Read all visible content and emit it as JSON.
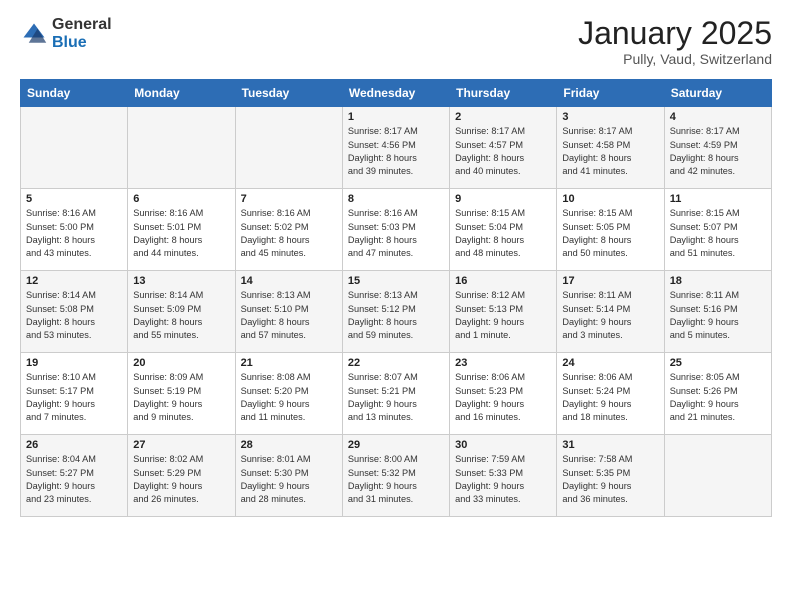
{
  "header": {
    "logo_line1": "General",
    "logo_line2": "Blue",
    "month": "January 2025",
    "location": "Pully, Vaud, Switzerland"
  },
  "days_of_week": [
    "Sunday",
    "Monday",
    "Tuesday",
    "Wednesday",
    "Thursday",
    "Friday",
    "Saturday"
  ],
  "weeks": [
    [
      {
        "day": "",
        "info": ""
      },
      {
        "day": "",
        "info": ""
      },
      {
        "day": "",
        "info": ""
      },
      {
        "day": "1",
        "info": "Sunrise: 8:17 AM\nSunset: 4:56 PM\nDaylight: 8 hours\nand 39 minutes."
      },
      {
        "day": "2",
        "info": "Sunrise: 8:17 AM\nSunset: 4:57 PM\nDaylight: 8 hours\nand 40 minutes."
      },
      {
        "day": "3",
        "info": "Sunrise: 8:17 AM\nSunset: 4:58 PM\nDaylight: 8 hours\nand 41 minutes."
      },
      {
        "day": "4",
        "info": "Sunrise: 8:17 AM\nSunset: 4:59 PM\nDaylight: 8 hours\nand 42 minutes."
      }
    ],
    [
      {
        "day": "5",
        "info": "Sunrise: 8:16 AM\nSunset: 5:00 PM\nDaylight: 8 hours\nand 43 minutes."
      },
      {
        "day": "6",
        "info": "Sunrise: 8:16 AM\nSunset: 5:01 PM\nDaylight: 8 hours\nand 44 minutes."
      },
      {
        "day": "7",
        "info": "Sunrise: 8:16 AM\nSunset: 5:02 PM\nDaylight: 8 hours\nand 45 minutes."
      },
      {
        "day": "8",
        "info": "Sunrise: 8:16 AM\nSunset: 5:03 PM\nDaylight: 8 hours\nand 47 minutes."
      },
      {
        "day": "9",
        "info": "Sunrise: 8:15 AM\nSunset: 5:04 PM\nDaylight: 8 hours\nand 48 minutes."
      },
      {
        "day": "10",
        "info": "Sunrise: 8:15 AM\nSunset: 5:05 PM\nDaylight: 8 hours\nand 50 minutes."
      },
      {
        "day": "11",
        "info": "Sunrise: 8:15 AM\nSunset: 5:07 PM\nDaylight: 8 hours\nand 51 minutes."
      }
    ],
    [
      {
        "day": "12",
        "info": "Sunrise: 8:14 AM\nSunset: 5:08 PM\nDaylight: 8 hours\nand 53 minutes."
      },
      {
        "day": "13",
        "info": "Sunrise: 8:14 AM\nSunset: 5:09 PM\nDaylight: 8 hours\nand 55 minutes."
      },
      {
        "day": "14",
        "info": "Sunrise: 8:13 AM\nSunset: 5:10 PM\nDaylight: 8 hours\nand 57 minutes."
      },
      {
        "day": "15",
        "info": "Sunrise: 8:13 AM\nSunset: 5:12 PM\nDaylight: 8 hours\nand 59 minutes."
      },
      {
        "day": "16",
        "info": "Sunrise: 8:12 AM\nSunset: 5:13 PM\nDaylight: 9 hours\nand 1 minute."
      },
      {
        "day": "17",
        "info": "Sunrise: 8:11 AM\nSunset: 5:14 PM\nDaylight: 9 hours\nand 3 minutes."
      },
      {
        "day": "18",
        "info": "Sunrise: 8:11 AM\nSunset: 5:16 PM\nDaylight: 9 hours\nand 5 minutes."
      }
    ],
    [
      {
        "day": "19",
        "info": "Sunrise: 8:10 AM\nSunset: 5:17 PM\nDaylight: 9 hours\nand 7 minutes."
      },
      {
        "day": "20",
        "info": "Sunrise: 8:09 AM\nSunset: 5:19 PM\nDaylight: 9 hours\nand 9 minutes."
      },
      {
        "day": "21",
        "info": "Sunrise: 8:08 AM\nSunset: 5:20 PM\nDaylight: 9 hours\nand 11 minutes."
      },
      {
        "day": "22",
        "info": "Sunrise: 8:07 AM\nSunset: 5:21 PM\nDaylight: 9 hours\nand 13 minutes."
      },
      {
        "day": "23",
        "info": "Sunrise: 8:06 AM\nSunset: 5:23 PM\nDaylight: 9 hours\nand 16 minutes."
      },
      {
        "day": "24",
        "info": "Sunrise: 8:06 AM\nSunset: 5:24 PM\nDaylight: 9 hours\nand 18 minutes."
      },
      {
        "day": "25",
        "info": "Sunrise: 8:05 AM\nSunset: 5:26 PM\nDaylight: 9 hours\nand 21 minutes."
      }
    ],
    [
      {
        "day": "26",
        "info": "Sunrise: 8:04 AM\nSunset: 5:27 PM\nDaylight: 9 hours\nand 23 minutes."
      },
      {
        "day": "27",
        "info": "Sunrise: 8:02 AM\nSunset: 5:29 PM\nDaylight: 9 hours\nand 26 minutes."
      },
      {
        "day": "28",
        "info": "Sunrise: 8:01 AM\nSunset: 5:30 PM\nDaylight: 9 hours\nand 28 minutes."
      },
      {
        "day": "29",
        "info": "Sunrise: 8:00 AM\nSunset: 5:32 PM\nDaylight: 9 hours\nand 31 minutes."
      },
      {
        "day": "30",
        "info": "Sunrise: 7:59 AM\nSunset: 5:33 PM\nDaylight: 9 hours\nand 33 minutes."
      },
      {
        "day": "31",
        "info": "Sunrise: 7:58 AM\nSunset: 5:35 PM\nDaylight: 9 hours\nand 36 minutes."
      },
      {
        "day": "",
        "info": ""
      }
    ]
  ]
}
